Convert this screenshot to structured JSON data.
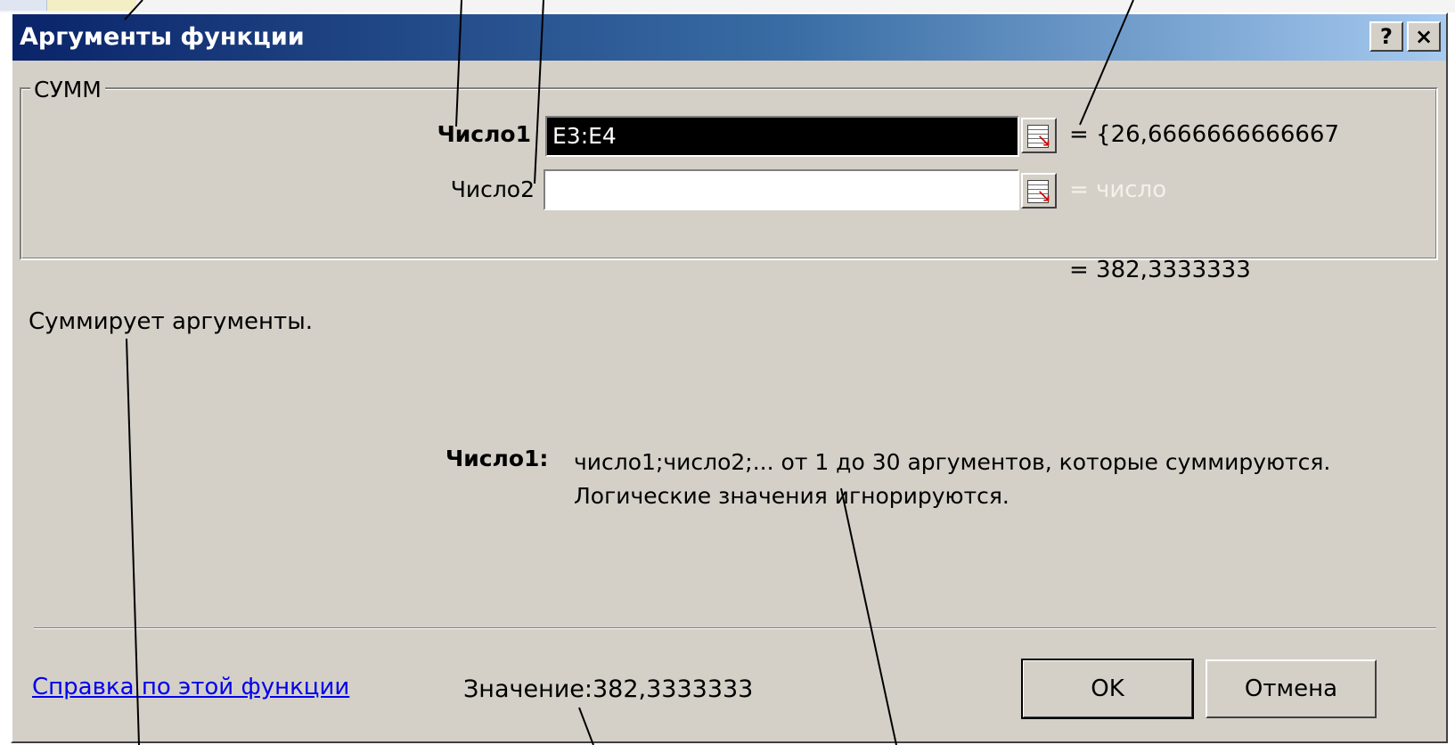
{
  "dialog": {
    "title": "Аргументы функции",
    "help_button": "?",
    "close_button": "×",
    "function_name": "СУММ",
    "args": [
      {
        "label": "Число1",
        "value": "E3:E4",
        "result": "= {26,6666666666667"
      },
      {
        "label": "Число2",
        "value": "",
        "result": "= число"
      }
    ],
    "formula_result": "= 382,3333333",
    "description": "Суммирует аргументы.",
    "arg_desc_name": "Число1:",
    "arg_desc_line1": "число1;число2;... от 1 до 30 аргументов, которые суммируются.",
    "arg_desc_line2": "Логические значения игнорируются.",
    "help_link": "Справка по этой функции",
    "value_label": "Значение:",
    "value": "382,3333333",
    "ok_button": "OK",
    "cancel_button": "Отмена"
  }
}
